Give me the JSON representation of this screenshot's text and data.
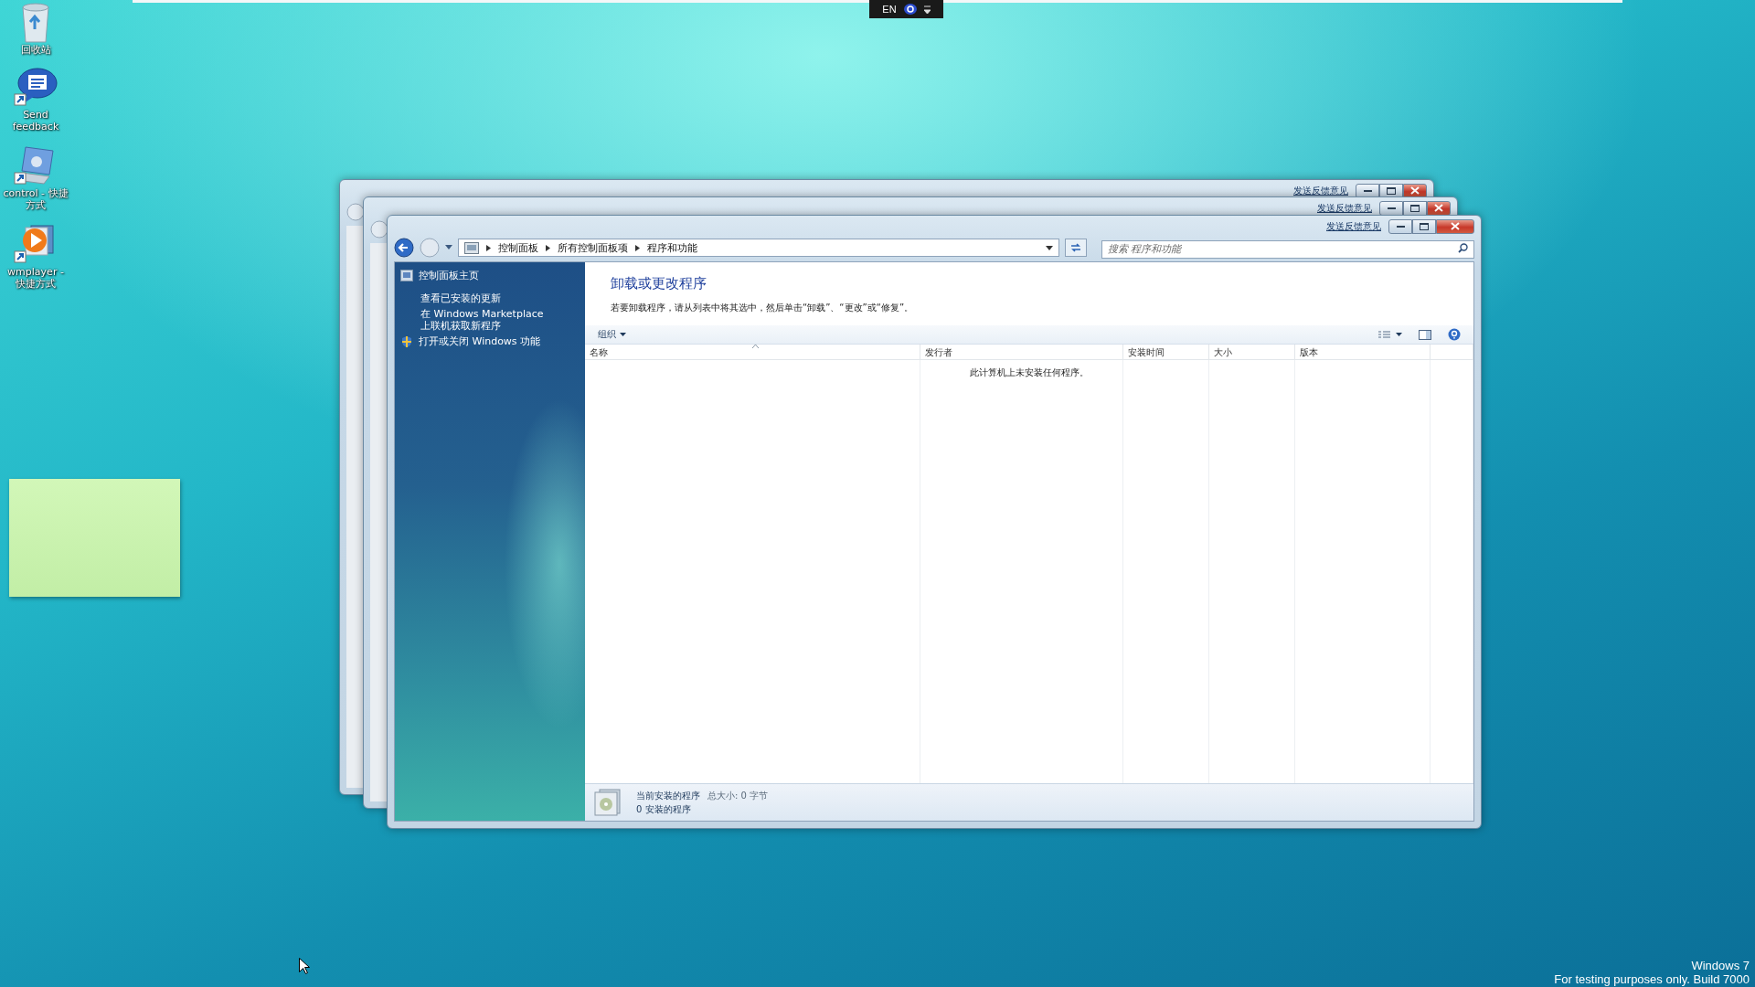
{
  "desktop": {
    "icons": [
      {
        "label": "回收站",
        "kind": "recycle"
      },
      {
        "label": "Send feedback",
        "kind": "feedback"
      },
      {
        "label": "control - 快捷方式",
        "kind": "control"
      },
      {
        "label": "wmplayer - 快捷方式",
        "kind": "player"
      }
    ],
    "os_notice": [
      "Windows 7",
      "For testing purposes only. Build 7000"
    ]
  },
  "language_bar": {
    "language": "EN"
  },
  "background_windows": [
    {
      "feedback_link": "发送反馈意见"
    },
    {
      "feedback_link": "发送反馈意见"
    }
  ],
  "window": {
    "feedback_link": "发送反馈意见",
    "breadcrumb": [
      "控制面板",
      "所有控制面板项",
      "程序和功能"
    ],
    "search": {
      "placeholder": "搜索 程序和功能"
    },
    "sidebar": {
      "items": [
        {
          "label": "控制面板主页",
          "kind": "home"
        },
        {
          "label": "查看已安装的更新",
          "kind": "link"
        },
        {
          "label": "在 Windows Marketplace 上联机获取新程序",
          "kind": "link"
        },
        {
          "label": "打开或关闭 Windows 功能",
          "kind": "shield"
        }
      ]
    },
    "heading": "卸载或更改程序",
    "description": "若要卸载程序，请从列表中将其选中，然后单击“卸载”、“更改”或“修复”。",
    "toolbar": {
      "organize": "组织"
    },
    "table": {
      "columns": [
        {
          "label": "名称",
          "sorted": true
        },
        {
          "label": "发行者",
          "sorted": false
        },
        {
          "label": "安装时间",
          "sorted": false
        },
        {
          "label": "大小",
          "sorted": false
        },
        {
          "label": "版本",
          "sorted": false
        }
      ],
      "empty_message": "此计算机上未安装任何程序。"
    },
    "status_bar": {
      "title": "当前安装的程序",
      "total": "总大小: 0 字节",
      "count": "0 安装的程序"
    }
  }
}
